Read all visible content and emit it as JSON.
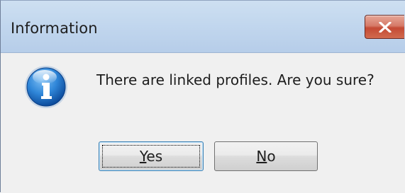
{
  "dialog": {
    "title": "Information",
    "message": "There are linked profiles. Are you sure?",
    "icon": "info-icon",
    "close_icon": "close-icon",
    "buttons": {
      "yes": {
        "mnemonic": "Y",
        "rest": "es"
      },
      "no": {
        "mnemonic": "N",
        "rest": "o"
      }
    },
    "focused_button": "yes",
    "colors": {
      "titlebar": "#c2d7ee",
      "close_button": "#c44a34",
      "body": "#f0f0f0",
      "info_icon": "#1e6fc4"
    }
  }
}
